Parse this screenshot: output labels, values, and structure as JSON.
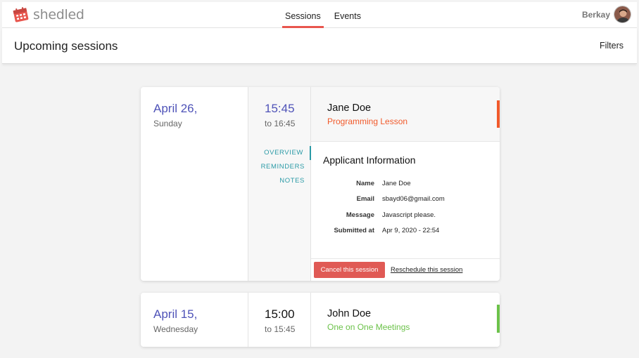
{
  "app": {
    "logo_text": "shedled",
    "nav": [
      {
        "label": "Sessions",
        "active": true
      },
      {
        "label": "Events",
        "active": false
      }
    ],
    "user_name": "Berkay"
  },
  "header": {
    "title": "Upcoming sessions",
    "filters_label": "Filters"
  },
  "sessions": [
    {
      "date": "April 26,",
      "weekday": "Sunday",
      "start_time": "15:45",
      "end_time": "to 16:45",
      "person": "Jane Doe",
      "type": "Programming Lesson",
      "type_color": "#f15a2b",
      "expanded": true,
      "tabs": [
        "OVERVIEW",
        "REMINDERS",
        "NOTES"
      ],
      "active_tab": "OVERVIEW",
      "info_title": "Applicant Information",
      "info": [
        {
          "label": "Name",
          "value": "Jane Doe"
        },
        {
          "label": "Email",
          "value": "sbayd06@gmail.com"
        },
        {
          "label": "Message",
          "value": "Javascript please."
        },
        {
          "label": "Submitted at",
          "value": "Apr 9, 2020 - 22:54"
        }
      ],
      "cancel_label": "Cancel this session",
      "reschedule_label": "Reschedule this session"
    },
    {
      "date": "April 15,",
      "weekday": "Wednesday",
      "start_time": "15:00",
      "end_time": "to 15:45",
      "person": "John Doe",
      "type": "One on One Meetings",
      "type_color": "#6cc24a",
      "expanded": false
    }
  ],
  "colors": {
    "accent": "#e8564e",
    "date_blue": "#4f53b8",
    "tab_teal": "#2a9aa6"
  }
}
